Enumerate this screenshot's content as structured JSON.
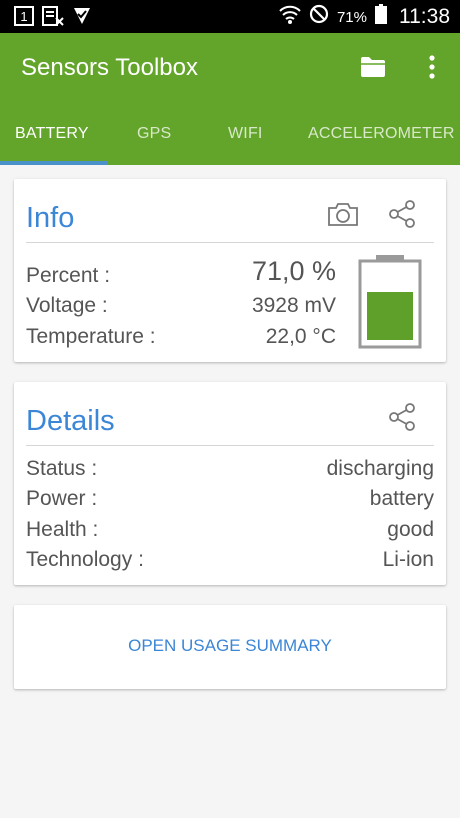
{
  "status_bar": {
    "sim_badge": "1",
    "battery_percent": "71%",
    "time": "11:38",
    "icons": [
      "sim-1-icon",
      "screen-cast-off-icon",
      "download-check-icon",
      "wifi-icon",
      "do-not-disturb-icon",
      "battery-icon"
    ]
  },
  "app_bar": {
    "title": "Sensors Toolbox",
    "actions": [
      "folder-icon",
      "more-vert-icon"
    ],
    "color": "#63a52a"
  },
  "tabs": [
    {
      "label": "BATTERY",
      "active": true
    },
    {
      "label": "GPS",
      "active": false
    },
    {
      "label": "WIFI",
      "active": false
    },
    {
      "label": "ACCELEROMETER",
      "active": false
    }
  ],
  "info_card": {
    "title": "Info",
    "actions": [
      "camera-icon",
      "share-icon"
    ],
    "rows": [
      {
        "label": "Percent :",
        "value": "71,0 %"
      },
      {
        "label": "Voltage :",
        "value": "3928 mV"
      },
      {
        "label": "Temperature :",
        "value": "22,0 °C"
      }
    ],
    "battery_level": 0.71,
    "battery_color": "#5fa02a"
  },
  "details_card": {
    "title": "Details",
    "actions": [
      "share-icon"
    ],
    "rows": [
      {
        "label": "Status :",
        "value": "discharging"
      },
      {
        "label": "Power :",
        "value": "battery"
      },
      {
        "label": "Health :",
        "value": "good"
      },
      {
        "label": "Technology :",
        "value": "Li-ion"
      }
    ]
  },
  "summary_card": {
    "link_label": "OPEN USAGE SUMMARY"
  },
  "colors": {
    "accent": "#3b86d6",
    "tab_indicator": "#4a90c9"
  }
}
